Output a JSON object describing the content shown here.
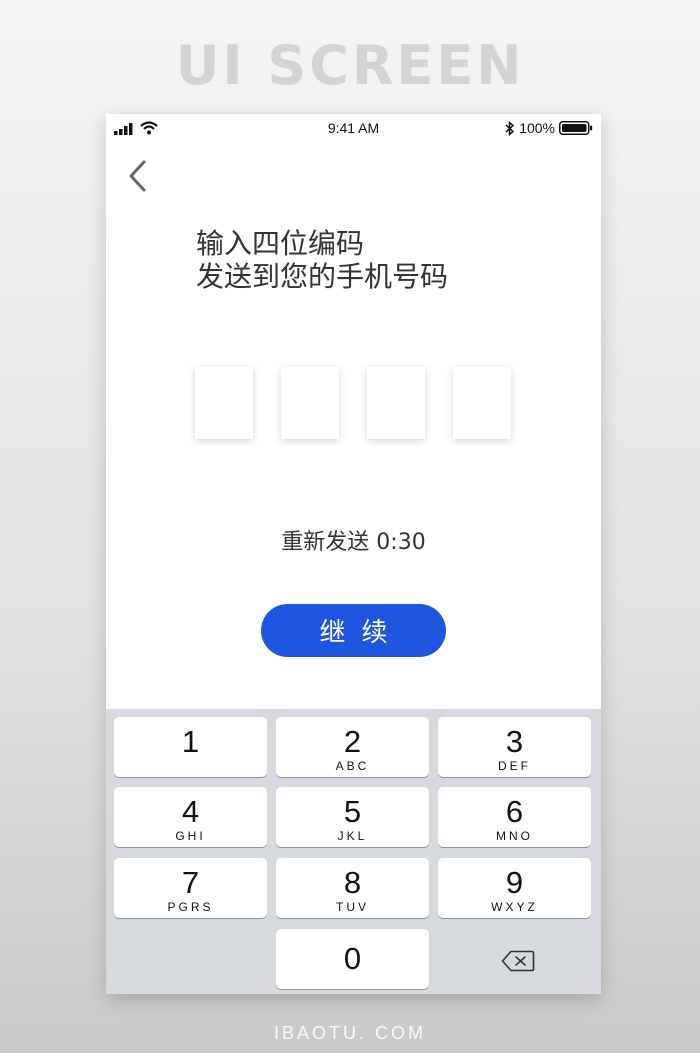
{
  "page_heading": "UI SCREEN",
  "status_bar": {
    "time": "9:41 AM",
    "battery": "100%"
  },
  "prompt": {
    "line1": "输入四位编码",
    "line2": "发送到您的手机号码"
  },
  "resend": {
    "label": "重新发送",
    "countdown": "0:30"
  },
  "continue_button": {
    "label": "继续"
  },
  "keypad": {
    "keys": [
      {
        "digit": "1",
        "letters": ""
      },
      {
        "digit": "2",
        "letters": "ABC"
      },
      {
        "digit": "3",
        "letters": "DEF"
      },
      {
        "digit": "4",
        "letters": "GHI"
      },
      {
        "digit": "5",
        "letters": "JKL"
      },
      {
        "digit": "6",
        "letters": "MNO"
      },
      {
        "digit": "7",
        "letters": "PGRS"
      },
      {
        "digit": "8",
        "letters": "TUV"
      },
      {
        "digit": "9",
        "letters": "WXYZ"
      },
      {
        "digit": "0",
        "letters": ""
      }
    ]
  },
  "icons": {
    "signal": "cellular-signal-icon",
    "wifi": "wifi-icon",
    "bluetooth": "bluetooth-icon",
    "battery": "battery-icon",
    "back": "chevron-left-icon",
    "delete": "backspace-icon"
  },
  "colors": {
    "accent": "#1f56e0",
    "keypad_bg": "#d6d9de"
  },
  "watermark": "IBAOTU. COM"
}
